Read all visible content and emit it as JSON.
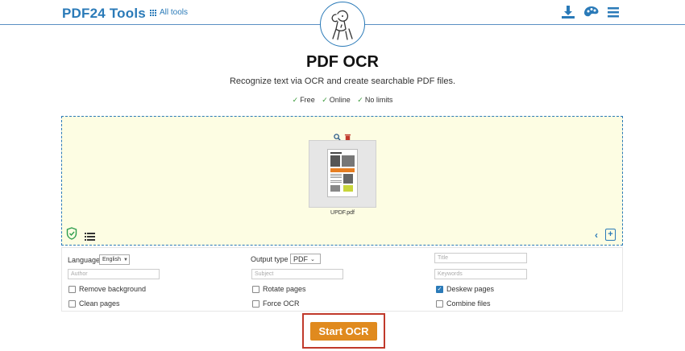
{
  "header": {
    "brand": "PDF24 Tools",
    "all_tools_label": "All tools",
    "icons": [
      "download-icon",
      "palette-icon",
      "menu-icon"
    ]
  },
  "main": {
    "title": "PDF OCR",
    "subtitle": "Recognize text via OCR and create searchable PDF files.",
    "features": [
      "Free",
      "Online",
      "No limits"
    ]
  },
  "file_area": {
    "file_name": "UPDF.pdf",
    "icons": [
      "zoom-icon",
      "trash-icon",
      "shield-icon",
      "list-icon",
      "chevron-left-icon",
      "add-file-icon"
    ]
  },
  "options": {
    "language_label": "Language",
    "language_value": "English",
    "output_type_label": "Output type",
    "output_type_value": "PDF",
    "title_placeholder": "Title",
    "author_placeholder": "Author",
    "subject_placeholder": "Subject",
    "keywords_placeholder": "Keywords",
    "remove_background": {
      "label": "Remove background",
      "checked": false
    },
    "rotate_pages": {
      "label": "Rotate pages",
      "checked": false
    },
    "deskew_pages": {
      "label": "Deskew pages",
      "checked": true
    },
    "clean_pages": {
      "label": "Clean pages",
      "checked": false
    },
    "force_ocr": {
      "label": "Force OCR",
      "checked": false
    },
    "combine_files": {
      "label": "Combine files",
      "checked": false
    }
  },
  "actions": {
    "start_label": "Start OCR"
  },
  "colors": {
    "brand": "#2a7ab8",
    "drop_bg": "#fdfde3",
    "start_button": "#e08a1e",
    "highlight": "#c0392b"
  }
}
